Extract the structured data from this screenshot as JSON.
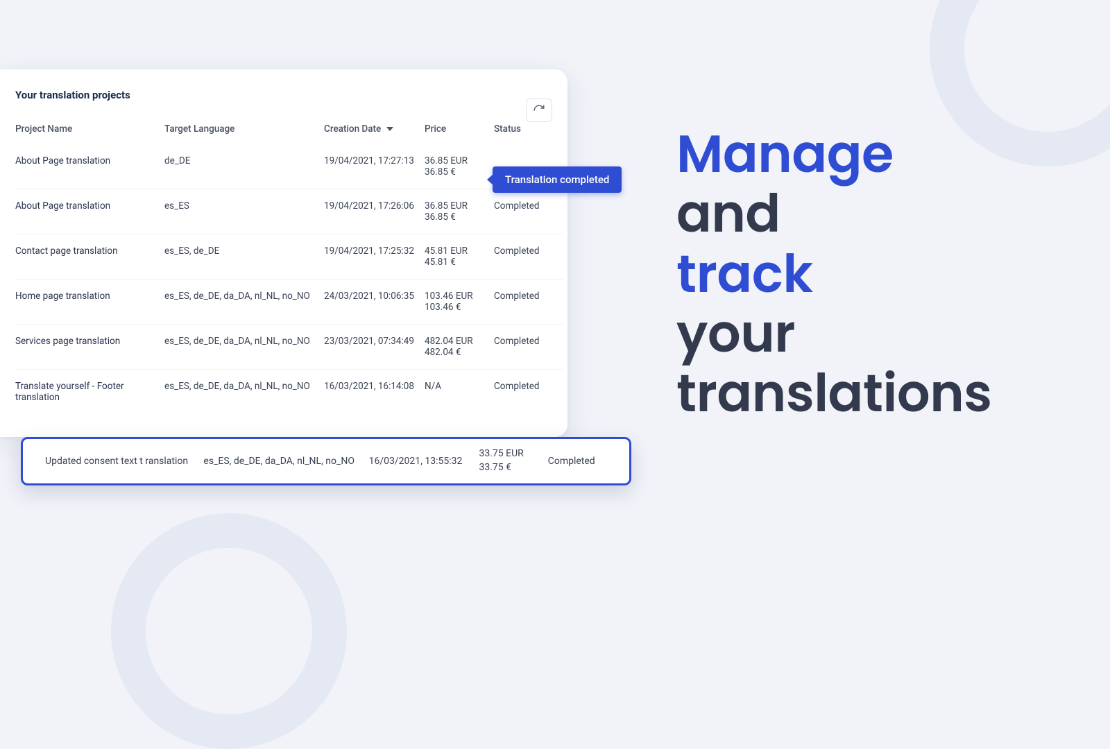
{
  "panel": {
    "title": "Your translation projects",
    "columns": {
      "name": "Project Name",
      "lang": "Target Language",
      "date": "Creation Date",
      "price": "Price",
      "status": "Status"
    },
    "rows": [
      {
        "name": "About Page translation",
        "lang": "de_DE",
        "date": "19/04/2021, 17:27:13",
        "price1": "36.85 EUR",
        "price2": "36.85 €",
        "status": ""
      },
      {
        "name": "About Page translation",
        "lang": "es_ES",
        "date": "19/04/2021, 17:26:06",
        "price1": "36.85 EUR",
        "price2": "36.85 €",
        "status": "Completed"
      },
      {
        "name": "Contact page translation",
        "lang": "es_ES, de_DE",
        "date": "19/04/2021, 17:25:32",
        "price1": "45.81 EUR",
        "price2": "45.81 €",
        "status": "Completed"
      },
      {
        "name": "Home page translation",
        "lang": "es_ES, de_DE, da_DA, nl_NL, no_NO",
        "date": "24/03/2021, 10:06:35",
        "price1": "103.46 EUR",
        "price2": "103.46 €",
        "status": "Completed"
      },
      {
        "name": "Services page translation",
        "lang": "es_ES, de_DE, da_DA, nl_NL, no_NO",
        "date": "23/03/2021, 07:34:49",
        "price1": "482.04 EUR",
        "price2": "482.04 €",
        "status": "Completed"
      },
      {
        "name": "Translate yourself - Footer translation",
        "lang": "es_ES, de_DE, da_DA, nl_NL, no_NO",
        "date": "16/03/2021, 16:14:08",
        "price1": "N/A",
        "price2": "",
        "status": "Completed"
      }
    ]
  },
  "tooltip": "Translation completed",
  "callout": {
    "name": "Updated consent text t ranslation",
    "lang": "es_ES, de_DE, da_DA, nl_NL, no_NO",
    "date": "16/03/2021, 13:55:32",
    "price1": "33.75 EUR",
    "price2": "33.75 €",
    "status": "Completed"
  },
  "hero": {
    "l1": "Manage",
    "l2": "and",
    "l3": "track",
    "l4": "your",
    "l5": "translations"
  }
}
